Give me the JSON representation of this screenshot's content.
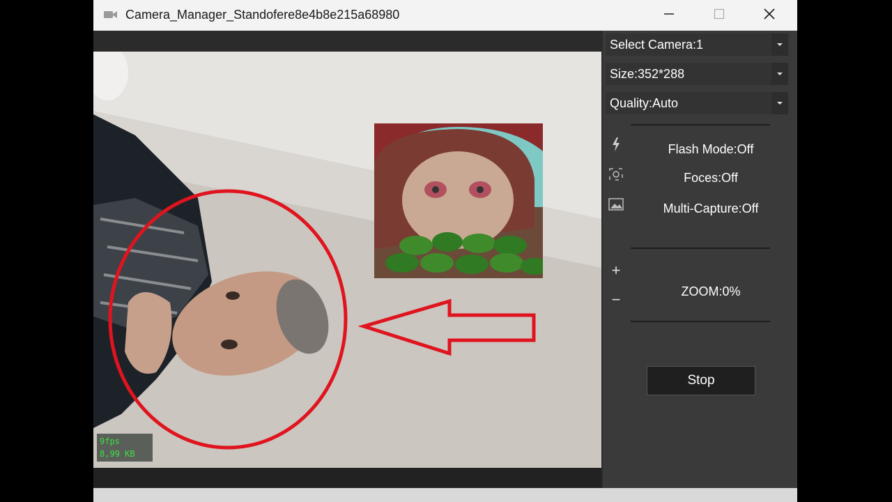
{
  "window": {
    "title": "Camera_Manager_Standofere8e4b8e215a68980"
  },
  "video": {
    "fps_text": "9fps",
    "size_text": "8,99 KB"
  },
  "controls": {
    "camera_select": "Select Camera:1",
    "size_select": "Size:352*288",
    "quality_select": "Quality:Auto",
    "flash_mode": "Flash Mode:Off",
    "focus": "Foces:Off",
    "multi_capture": "Multi-Capture:Off",
    "zoom_in": "+",
    "zoom_out": "−",
    "zoom": "ZOOM:0%",
    "stop_label": "Stop"
  },
  "annotations": {
    "color": "#e0141e"
  },
  "icons": {
    "app": "camera-icon",
    "flash": "flash-icon",
    "focus": "focus-icon",
    "multi": "image-icon"
  }
}
